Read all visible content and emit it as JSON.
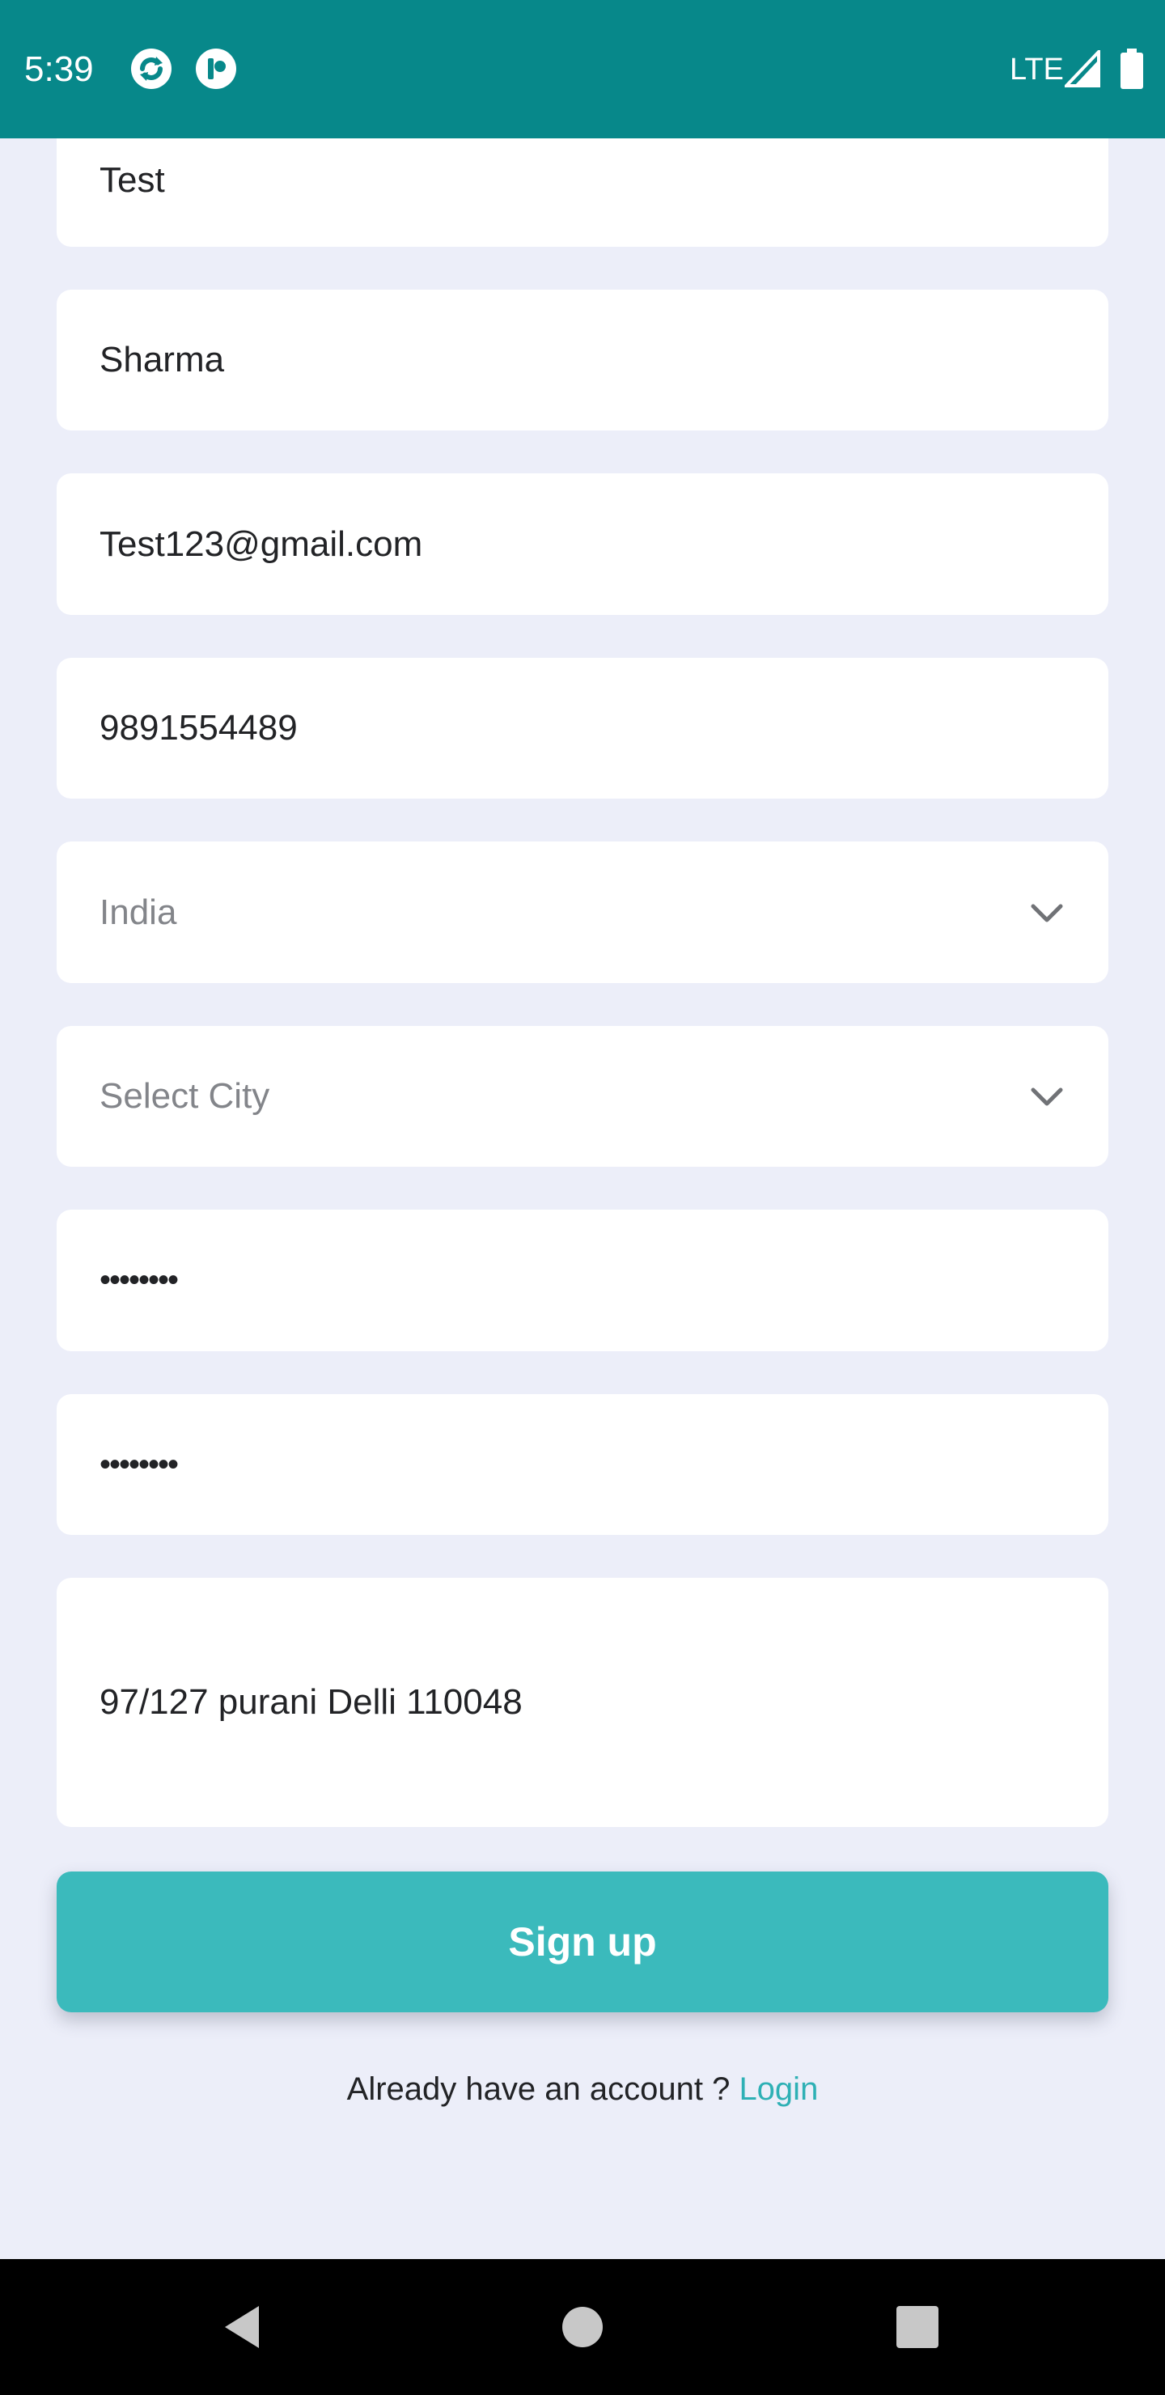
{
  "status_bar": {
    "time": "5:39",
    "network": "LTE",
    "background_color": "#07888A"
  },
  "form": {
    "first_name": {
      "value": "Test"
    },
    "last_name": {
      "value": "Sharma"
    },
    "email": {
      "value": "Test123@gmail.com"
    },
    "phone": {
      "value": "9891554489"
    },
    "country_select": {
      "selected": "India"
    },
    "city_select": {
      "placeholder": "Select City"
    },
    "password": {
      "value": "••••••••"
    },
    "confirm_password": {
      "value": "••••••••"
    },
    "address": {
      "value": "97/127 purani Delli 110048"
    },
    "signup_button_label": "Sign up",
    "accent_color": "#3BBABC"
  },
  "footer": {
    "login_prompt": "Already have an account ? ",
    "login_link": "Login",
    "link_color": "#2EB0B5"
  },
  "nav_bar": {
    "icons": [
      "back-icon",
      "home-icon",
      "recents-icon"
    ]
  }
}
